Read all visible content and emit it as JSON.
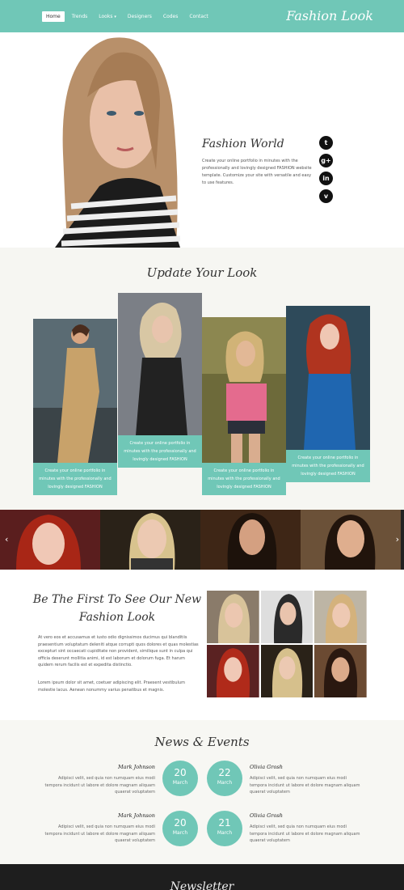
{
  "header": {
    "brand": "Fashion Look",
    "nav": [
      {
        "label": "Home",
        "active": true
      },
      {
        "label": "Trends"
      },
      {
        "label": "Looks"
      },
      {
        "label": "Designers"
      },
      {
        "label": "Codes"
      },
      {
        "label": "Contact"
      }
    ],
    "accent_color": "#70c7b7"
  },
  "hero": {
    "title": "Fashion World",
    "text": "Create your online portfolio in minutes with the professionally and lovingly designed FASHION website template. Customize your site with versatile and easy to use features.",
    "social_icons": [
      "twitter-icon",
      "google-plus-icon",
      "linkedin-icon",
      "vimeo-icon"
    ]
  },
  "update": {
    "title": "Update Your Look",
    "cards": [
      {
        "caption": "Create your online portfolio in minutes with the professionally and lovingly designed FASHION"
      },
      {
        "caption": "Create your online portfolio in minutes with the professionally and lovingly designed FASHION"
      },
      {
        "caption": "Create your online portfolio in minutes with the professionally and lovingly designed FASHION"
      },
      {
        "caption": "Create your online portfolio in minutes with the professionally and lovingly designed FASHION"
      }
    ]
  },
  "first": {
    "title": "Be The First To See Our New Fashion Look",
    "p1": "At vero eos et accusamus et iusto odio dignissimos ducimus qui blanditiis praesentium voluptatum deleniti atque corrupti quos dolores et quas molestias excepturi sint occaecati cupiditate non provident, similique sunt in culpa qui officia deserunt mollitia animi, id est laborum et dolorum fuga. Et harum quidem rerum facilis est et expedita distinctio.",
    "p2": "Lorem ipsum dolor sit amet, coetuer adipiscing elit. Praesent vestibulum molestie lacus. Aenean nonummy varius penatibus et magnis."
  },
  "news": {
    "title": "News & Events",
    "events": [
      {
        "name": "Mark Johnson",
        "day": "20",
        "month": "March",
        "text": "Adipisci velit, sed quia non numquam eius modi tempora incidunt ut labore et dolore magnam aliquam quaerat voluptatem"
      },
      {
        "name": "Olivia Grosh",
        "day": "22",
        "month": "March",
        "text": "Adipisci velit, sed quia non numquam eius modi tempora incidunt ut labore et dolore magnam aliquam quaerat voluptatem"
      },
      {
        "name": "Mark Johnson",
        "day": "20",
        "month": "March",
        "text": "Adipisci velit, sed quia non numquam eius modi tempora incidunt ut labore et dolore magnam aliquam quaerat voluptatem"
      },
      {
        "name": "Olivia Grosh",
        "day": "21",
        "month": "March",
        "text": "Adipisci velit, sed quia non numquam eius modi tempora incidunt ut labore et dolore magnam aliquam quaerat voluptatem"
      }
    ]
  },
  "newsletter": {
    "title": "Newsletter"
  }
}
